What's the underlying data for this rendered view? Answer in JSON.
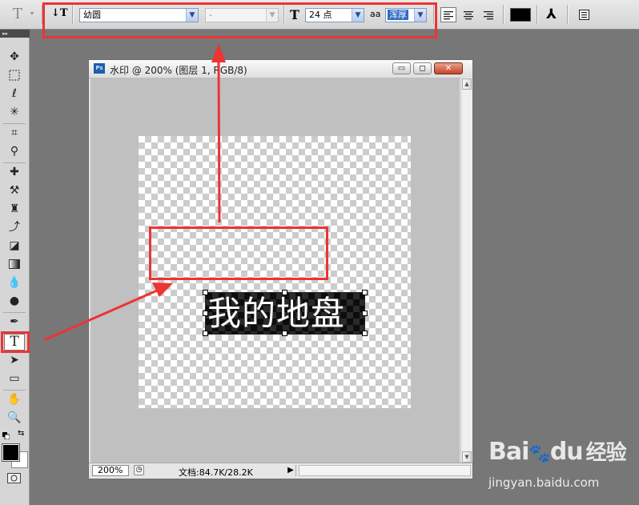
{
  "options_bar": {
    "tool_preset_glyph": "T",
    "font_family": "幼圆",
    "font_style": "-",
    "font_size": "24 点",
    "antialias_label": "aa",
    "antialias": "浑厚",
    "orientation_glyph": "↓T",
    "size_glyph": "T",
    "warp_glyph": "⅄"
  },
  "tools_panel": {
    "grip_label": "▸▸",
    "active_tool_glyph": "T"
  },
  "document": {
    "title": "水印 @ 200% (图层 1, RGB/8)",
    "app_badge": "Ps",
    "minimize_glyph": "▭",
    "restore_glyph": "◻",
    "close_glyph": "✕",
    "text_content": "我的地盘",
    "zoom": "200%",
    "doc_info": "文档:84.7K/28.2K"
  },
  "watermark": {
    "brand_text": "Bai",
    "brand_paw": "du",
    "brand_cn": "经验",
    "url": "jingyan.baidu.com"
  },
  "colors": {
    "annotation_red": "#ee3333",
    "workspace_gray": "#777777",
    "foreground": "#000000",
    "background": "#ffffff"
  }
}
